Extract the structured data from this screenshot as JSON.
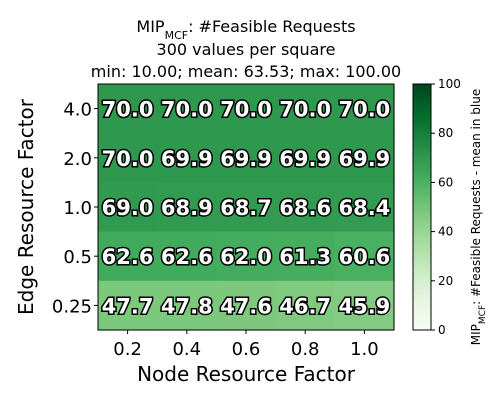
{
  "chart_data": {
    "type": "heatmap",
    "title_lines": [
      {
        "main": "MIP",
        "sub": "MCF",
        "rest": ": #Feasible Requests"
      },
      {
        "main": "300 values per square",
        "sub": "",
        "rest": ""
      },
      {
        "main": "min: 10.00; mean: 63.53; max: 100.00",
        "sub": "",
        "rest": ""
      }
    ],
    "xlabel": "Node Resource Factor",
    "ylabel": "Edge Resource Factor",
    "x_categories": [
      "0.2",
      "0.4",
      "0.6",
      "0.8",
      "1.0"
    ],
    "y_categories": [
      "4.0",
      "2.0",
      "1.0",
      "0.5",
      "0.25"
    ],
    "values": [
      [
        70.0,
        70.0,
        70.0,
        70.0,
        70.0
      ],
      [
        70.0,
        69.9,
        69.9,
        69.9,
        69.9
      ],
      [
        69.0,
        68.9,
        68.7,
        68.6,
        68.4
      ],
      [
        62.6,
        62.6,
        62.0,
        61.3,
        60.6
      ],
      [
        47.7,
        47.8,
        47.6,
        46.7,
        45.9
      ]
    ],
    "value_labels": [
      [
        "70.0",
        "70.0",
        "70.0",
        "70.0",
        "70.0"
      ],
      [
        "70.0",
        "69.9",
        "69.9",
        "69.9",
        "69.9"
      ],
      [
        "69.0",
        "68.9",
        "68.7",
        "68.6",
        "68.4"
      ],
      [
        "62.6",
        "62.6",
        "62.0",
        "61.3",
        "60.6"
      ],
      [
        "47.7",
        "47.8",
        "47.6",
        "46.7",
        "45.9"
      ]
    ],
    "colorbar": {
      "min": 0,
      "max": 100,
      "ticks": [
        "0",
        "20",
        "40",
        "60",
        "80",
        "100"
      ],
      "label_main": "MIP",
      "label_sub": "MCF",
      "label_rest": ": #Feasible Requests - mean in blue",
      "colormap": "Greens"
    }
  }
}
